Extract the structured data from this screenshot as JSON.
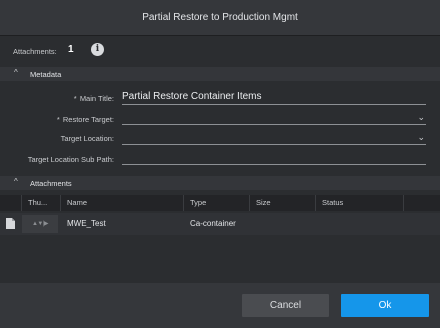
{
  "dialog": {
    "title": "Partial Restore to Production Mgmt"
  },
  "attachments_summary": {
    "label": "Attachments:",
    "count": "1",
    "info_icon": "info-icon"
  },
  "metadata": {
    "section_label": "Metadata",
    "fields": {
      "main_title": {
        "label": "Main Title:",
        "required": true,
        "value": "Partial Restore Container Items"
      },
      "restore_target": {
        "label": "Restore Target:",
        "required": true,
        "value": ""
      },
      "target_location": {
        "label": "Target Location:",
        "required": false,
        "value": ""
      },
      "target_location_sub_path": {
        "label": "Target Location Sub Path:",
        "required": false,
        "value": ""
      }
    },
    "required_marker": "*"
  },
  "attachments": {
    "section_label": "Attachments",
    "columns": [
      "Thu...",
      "Name",
      "Type",
      "Size",
      "Status"
    ],
    "rows": [
      {
        "thumbnail": "▲▼|▶",
        "name": "MWE_Test",
        "type": "Ca-container",
        "size": "",
        "status": ""
      }
    ]
  },
  "footer": {
    "cancel_label": "Cancel",
    "ok_label": "Ok"
  },
  "colors": {
    "background": "#2b2d30",
    "accent": "#1596ea"
  }
}
